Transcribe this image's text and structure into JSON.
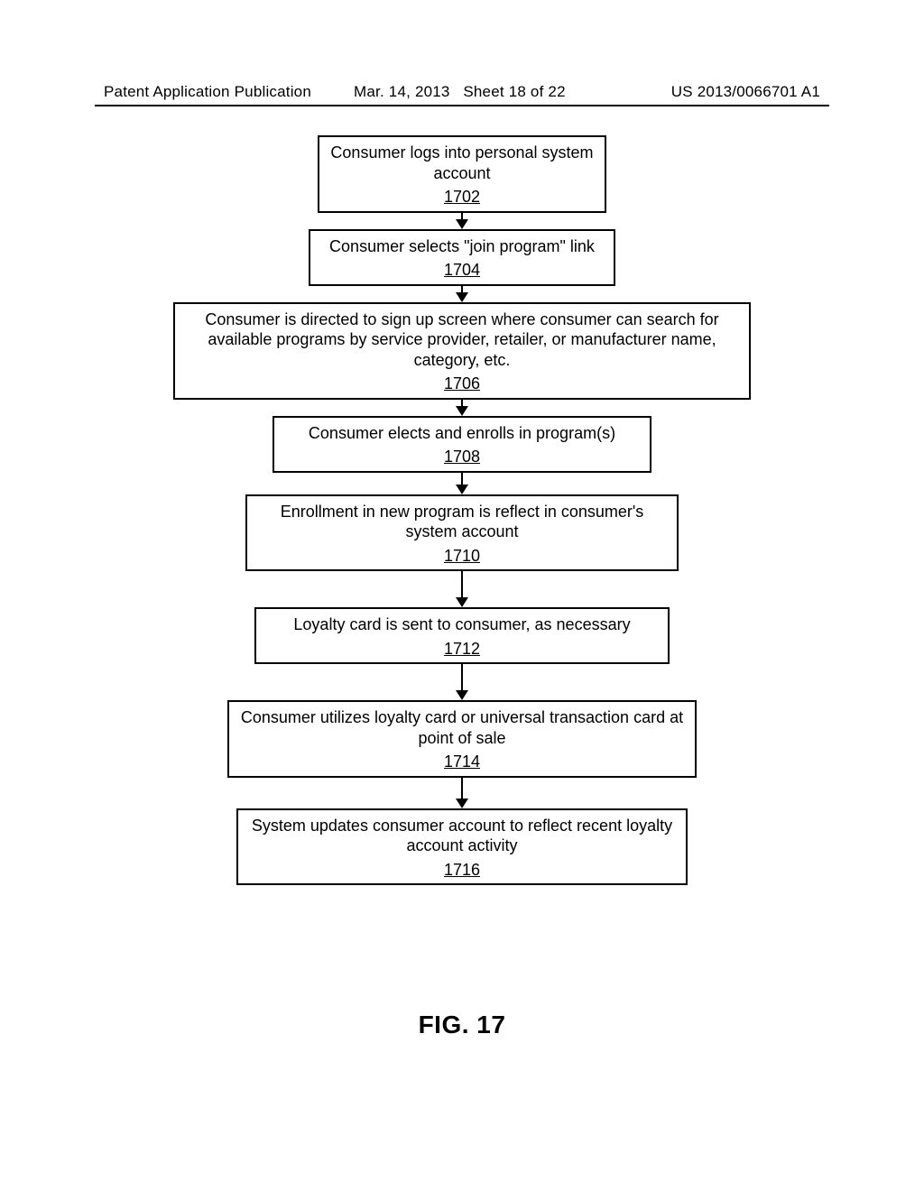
{
  "header": {
    "left": "Patent Application Publication",
    "mid_date": "Mar. 14, 2013",
    "mid_sheet": "Sheet 18 of 22",
    "right": "US 2013/0066701 A1"
  },
  "figure_label": "FIG. 17",
  "steps": [
    {
      "text": "Consumer logs into personal system account",
      "ref": "1702"
    },
    {
      "text": "Consumer selects \"join program\" link",
      "ref": "1704"
    },
    {
      "text": "Consumer is directed to sign up screen where consumer can search for available programs by service provider, retailer, or manufacturer name, category, etc.",
      "ref": "1706"
    },
    {
      "text": "Consumer elects and enrolls in program(s)",
      "ref": "1708"
    },
    {
      "text": "Enrollment in new program is reflect in consumer's system account",
      "ref": "1710"
    },
    {
      "text": "Loyalty card is sent to consumer, as necessary",
      "ref": "1712"
    },
    {
      "text": "Consumer utilizes loyalty card or universal transaction card at point of sale",
      "ref": "1714"
    },
    {
      "text": "System updates consumer account to reflect recent loyalty account activity",
      "ref": "1716"
    }
  ]
}
